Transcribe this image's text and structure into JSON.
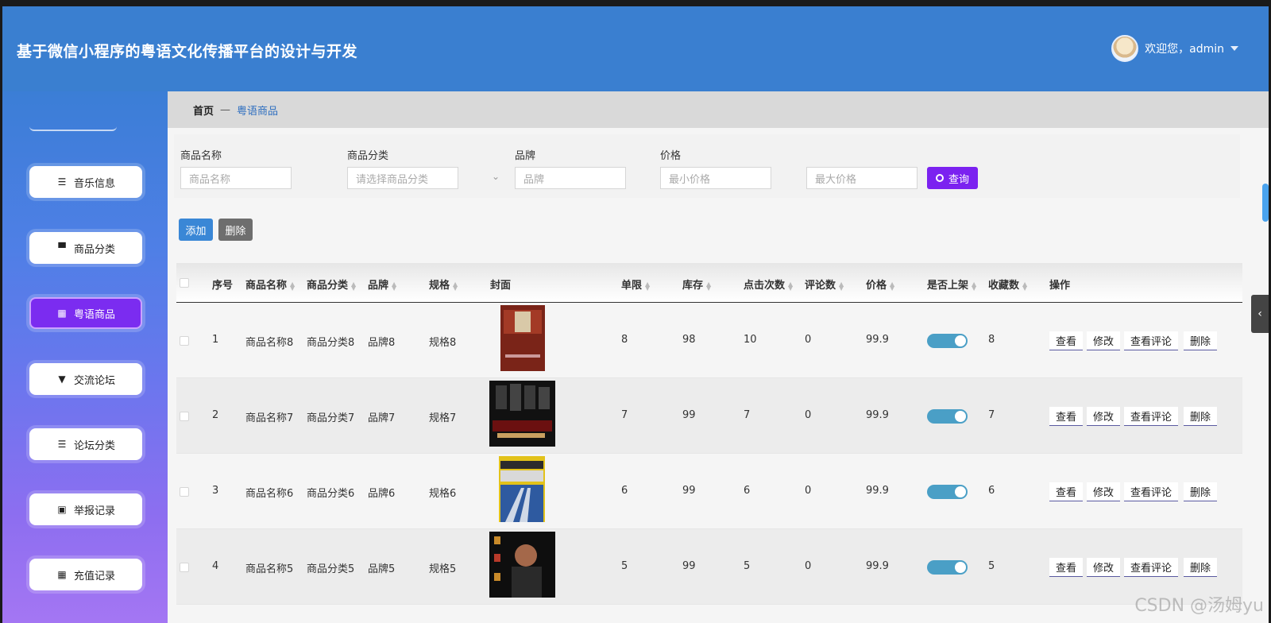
{
  "header": {
    "title": "基于微信小程序的粤语文化传播平台的设计与开发",
    "welcome": "欢迎您，admin"
  },
  "sidebar": {
    "items": [
      {
        "label": "音乐信息",
        "icon": "list-icon",
        "active": false
      },
      {
        "label": "商品分类",
        "icon": "monitor-icon",
        "active": false
      },
      {
        "label": "粤语商品",
        "icon": "grid-icon",
        "active": true
      },
      {
        "label": "交流论坛",
        "icon": "forum-icon",
        "active": false
      },
      {
        "label": "论坛分类",
        "icon": "list-icon",
        "active": false
      },
      {
        "label": "举报记录",
        "icon": "clipboard-icon",
        "active": false
      },
      {
        "label": "充值记录",
        "icon": "grid-icon",
        "active": false
      }
    ]
  },
  "breadcrumb": {
    "home": "首页",
    "sep": "—",
    "current": "粤语商品"
  },
  "filters": {
    "name_label": "商品名称",
    "name_placeholder": "商品名称",
    "category_label": "商品分类",
    "category_placeholder": "请选择商品分类",
    "brand_label": "品牌",
    "brand_placeholder": "品牌",
    "price_label": "价格",
    "min_placeholder": "最小价格",
    "max_placeholder": "最大价格",
    "query_label": "查询"
  },
  "actions": {
    "add": "添加",
    "delete": "删除"
  },
  "table": {
    "headers": {
      "index": "序号",
      "name": "商品名称",
      "category": "商品分类",
      "brand": "品牌",
      "spec": "规格",
      "cover": "封面",
      "limit": "单限",
      "stock": "库存",
      "clicks": "点击次数",
      "comments": "评论数",
      "price": "价格",
      "onsale": "是否上架",
      "favorites": "收藏数",
      "ops": "操作"
    },
    "ops": {
      "view": "查看",
      "edit": "修改",
      "view_comments": "查看评论",
      "delete": "删除"
    },
    "rows": [
      {
        "index": "1",
        "name": "商品名称8",
        "category": "商品分类8",
        "brand": "品牌8",
        "spec": "规格8",
        "limit": "8",
        "stock": "98",
        "clicks": "10",
        "comments": "0",
        "price": "99.9",
        "onsale": true,
        "favorites": "8"
      },
      {
        "index": "2",
        "name": "商品名称7",
        "category": "商品分类7",
        "brand": "品牌7",
        "spec": "规格7",
        "limit": "7",
        "stock": "99",
        "clicks": "7",
        "comments": "0",
        "price": "99.9",
        "onsale": true,
        "favorites": "7"
      },
      {
        "index": "3",
        "name": "商品名称6",
        "category": "商品分类6",
        "brand": "品牌6",
        "spec": "规格6",
        "limit": "6",
        "stock": "99",
        "clicks": "6",
        "comments": "0",
        "price": "99.9",
        "onsale": true,
        "favorites": "6"
      },
      {
        "index": "4",
        "name": "商品名称5",
        "category": "商品分类5",
        "brand": "品牌5",
        "spec": "规格5",
        "limit": "5",
        "stock": "99",
        "clicks": "5",
        "comments": "0",
        "price": "99.9",
        "onsale": true,
        "favorites": "5"
      }
    ]
  },
  "watermark": "CSDN @汤姆yu"
}
